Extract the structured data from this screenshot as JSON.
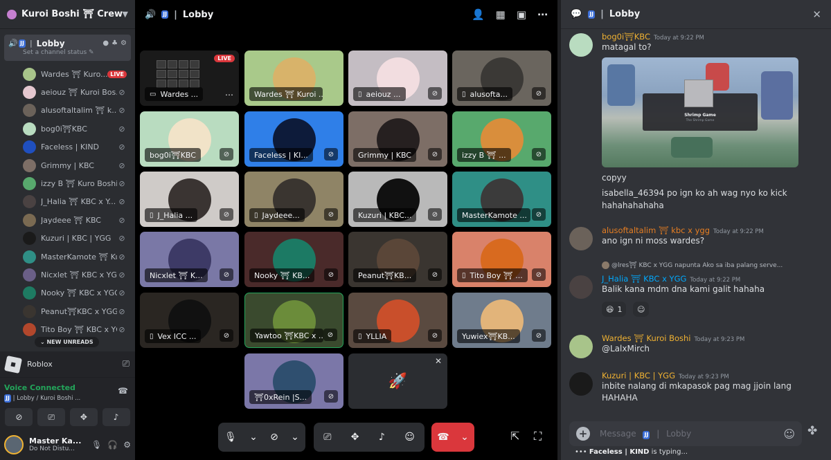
{
  "sidebar": {
    "server_name": "Kuroi Boshi ⛩ Crew",
    "channel": {
      "icon_badge": "JJ",
      "name": "Lobby",
      "status_placeholder": "Set a channel status ✎"
    },
    "voice_users": [
      {
        "name": "Wardes ⛩ Kuro...",
        "badge": "LIVE",
        "avatar_color": "#a8c48a"
      },
      {
        "name": "aeiouz ⛩ Kuroi Bos...",
        "avatar_color": "#e4c7cf"
      },
      {
        "name": "alusoftaltalim ⛩ k...",
        "avatar_color": "#6b625a"
      },
      {
        "name": "bog0i⛩KBC",
        "avatar_color": "#b9dcc0"
      },
      {
        "name": "Faceless | KIND",
        "avatar_color": "#1f4fbf"
      },
      {
        "name": "Grimmy | KBC",
        "avatar_color": "#7d6e66"
      },
      {
        "name": "izzy B ⛩ Kuro Boshi",
        "avatar_color": "#58a96d"
      },
      {
        "name": "J_Halia ⛩ KBC x Y...",
        "avatar_color": "#4a4242"
      },
      {
        "name": "Jaydeee ⛩ KBC",
        "avatar_color": "#7a6a52"
      },
      {
        "name": "Kuzuri | KBC | YGG",
        "avatar_color": "#1a1a1a"
      },
      {
        "name": "MasterKamote ⛩ Kur...",
        "avatar_color": "#2f8f86"
      },
      {
        "name": "Nicxlet ⛩ KBC x YG...",
        "avatar_color": "#6a5f87"
      },
      {
        "name": "Nooky ⛩ KBC x YGG",
        "avatar_color": "#1e7b62"
      },
      {
        "name": "Peanut⛩KBC x YGG",
        "avatar_color": "#3a3530"
      },
      {
        "name": "Tito Boy ⛩ KBC x YGG",
        "avatar_color": "#b2472c"
      }
    ],
    "new_unreads": "⌄ NEW UNREADS",
    "activity": {
      "name": "Roblox"
    },
    "voice": {
      "status": "Voice Connected",
      "channel_badge": "JJ",
      "channel": "Lobby / Kuroi Boshi ..."
    },
    "user": {
      "name": "Master Ka...",
      "status": "Do Not Distu..."
    }
  },
  "stage": {
    "channel_badge": "JJ",
    "channel_name": "Lobby",
    "live_label": "LIVE",
    "tiles": [
      {
        "label": "Wardes ...",
        "device": "▭",
        "bg": "#1a1a1a",
        "type": "screen"
      },
      {
        "label": "Wardes ⛩ Kuroi ...",
        "device": "",
        "bg": "#a9c98a",
        "face": "#d8b36a"
      },
      {
        "label": "aeiouz ...",
        "device": "▯",
        "bg": "#c4bdc3",
        "face": "#f2dde0"
      },
      {
        "label": "alusofta...",
        "device": "▯",
        "bg": "#6a655e",
        "face": "#3b3936"
      },
      {
        "label": "bog0i⛩KBC",
        "device": "",
        "bg": "#b9dcc0",
        "face": "#f1e3c8"
      },
      {
        "label": "Faceless | KI...",
        "device": "",
        "bg": "#2f7fe8",
        "face": "#0d1b3a"
      },
      {
        "label": "Grimmy | KBC",
        "device": "",
        "bg": "#7d6e66",
        "face": "#262020"
      },
      {
        "label": "izzy B ⛩ ...",
        "device": "",
        "bg": "#58a96d",
        "face": "#d98e3c"
      },
      {
        "label": "J_Halia ...",
        "device": "▯",
        "bg": "#cfcbc8",
        "face": "#3a3432"
      },
      {
        "label": "Jaydeee...",
        "device": "▯",
        "bg": "#8f8466",
        "face": "#3a3530"
      },
      {
        "label": "Kuzuri | KBC...",
        "device": "",
        "bg": "#b9b9b9",
        "face": "#111111"
      },
      {
        "label": "MasterKamote ...",
        "device": "",
        "bg": "#2f8f86",
        "face": "#3b3b3b"
      },
      {
        "label": "Nicxlet ⛩ K...",
        "device": "",
        "bg": "#7a78a6",
        "face": "#3d3a66"
      },
      {
        "label": "Nooky ⛩ KB...",
        "device": "",
        "bg": "#4a2a2a",
        "face": "#1c7a64"
      },
      {
        "label": "Peanut⛩KB...",
        "device": "",
        "bg": "#3a3530",
        "face": "#5a4638"
      },
      {
        "label": "Tito Boy ⛩ ...",
        "device": "▯",
        "bg": "#d9826a",
        "face": "#d86a1f"
      },
      {
        "label": "Vex ICC ...",
        "device": "▯",
        "bg": "#2a2622",
        "face": "#111111"
      },
      {
        "label": "Yawtoo ⛩KBC x ...",
        "device": "",
        "bg": "#3a4a2e",
        "face": "#6b8c3a"
      },
      {
        "label": "YLLIA",
        "device": "▯",
        "bg": "#5a4a40",
        "face": "#c94f2b"
      },
      {
        "label": "Yuwiex⛩KB...",
        "device": "",
        "bg": "#6f7c8c",
        "face": "#e2b47a"
      },
      {
        "label": "⛩0xRein |S...",
        "device": "",
        "bg": "#7b77a8",
        "face": "#2f4f6f"
      }
    ]
  },
  "chat": {
    "channel_badge": "JJ",
    "channel_name": "Lobby",
    "messages": [
      {
        "author": "bog0i⛩KBC",
        "color": "#f0b232",
        "time": "Today at 9:22 PM",
        "text": "matagal to?",
        "avatar": "#b9dcc0"
      },
      {
        "author": "alusoftaltalim ⛩ kbc x ygg",
        "color": "#e67e22",
        "time": "Today at 9:22 PM",
        "text": "ano ign ni moss wardes?",
        "avatar": "#6b625a"
      },
      {
        "author": "J_Halia ⛩ KBC x YGG",
        "color": "#00a8fc",
        "time": "Today at 9:22 PM",
        "text": "Balik kana mdm dna kami galit hahaha",
        "avatar": "#4a4242"
      },
      {
        "author": "Wardes ⛩ Kuroi Boshi",
        "color": "#f0b232",
        "time": "Today at 9:23 PM",
        "text": "@LalxMirch",
        "avatar": "#a8c48a"
      },
      {
        "author": "Kuzuri | KBC | YGG",
        "color": "#f0b232",
        "time": "Today at 9:23 PM",
        "text": "inbite nalang di mkapasok pag mag jjoin lang HAHAHA",
        "avatar": "#1a1a1a"
      }
    ],
    "embed": {
      "title": "Shrimp Game",
      "subtitle": "The Shrimp Game"
    },
    "extra_lines": [
      "copyy",
      "isabella_46394 po ign ko ah wag nyo ko kick",
      "hahahahahaha"
    ],
    "reply_preview": "@lres⛩ KBC x YGG napunta Ako sa iba palang serve...",
    "reaction": {
      "emoji": "😆",
      "count": "1",
      "add": "☺"
    },
    "input": {
      "placeholder": "Message",
      "badge": "JJ",
      "channel": "Lobby"
    },
    "typing": {
      "user": "Faceless | KIND",
      "suffix": " is typing..."
    }
  }
}
